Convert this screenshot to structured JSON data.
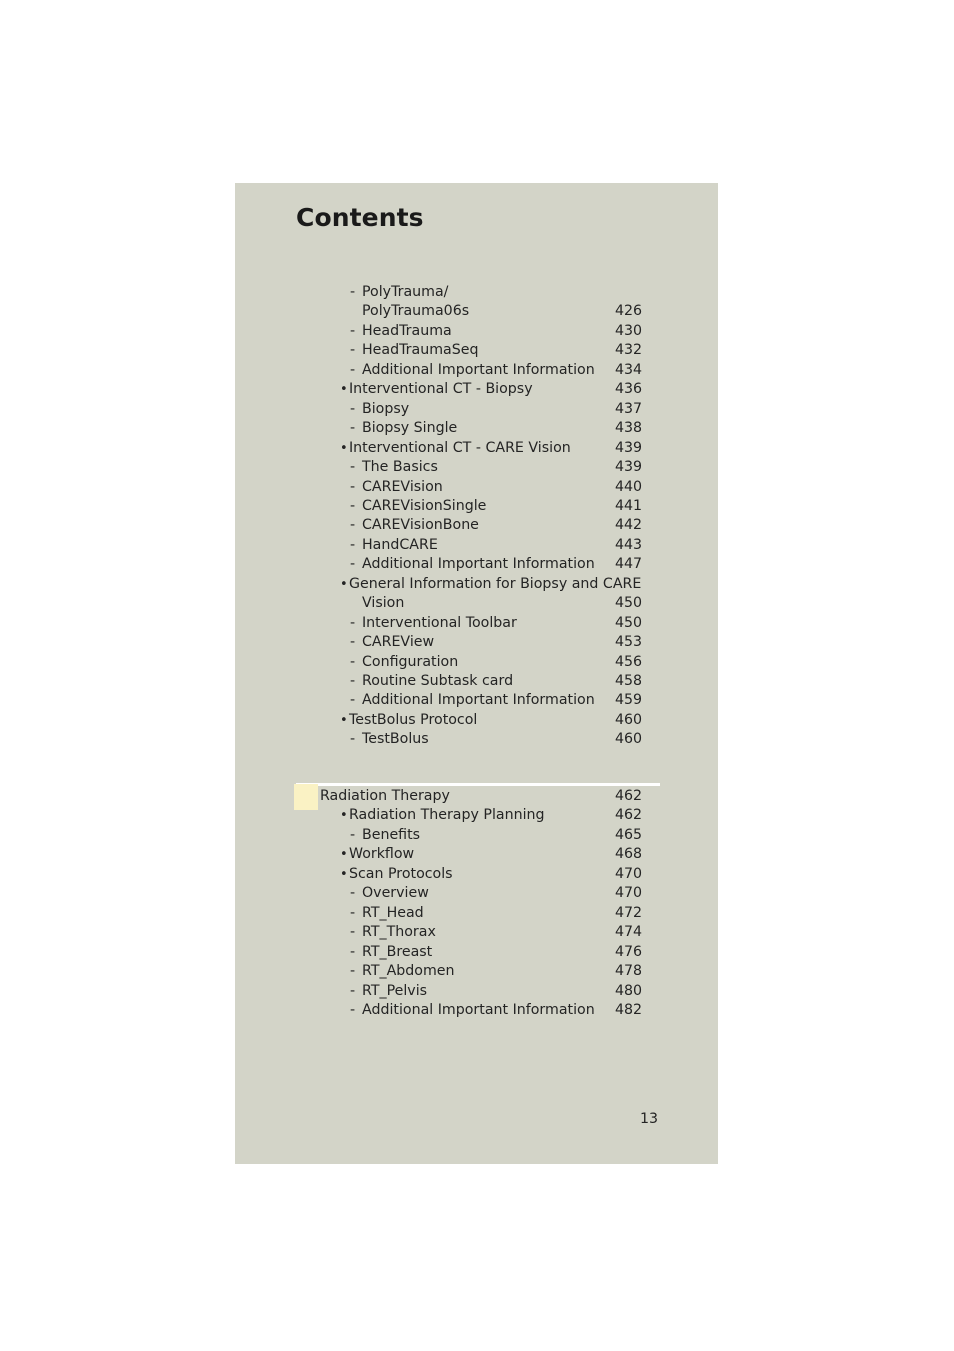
{
  "page": {
    "title": "Contents",
    "folio": "13",
    "background_color": "#d3d4c8",
    "rule_color": "#ffffff",
    "tab_marker_color": "#faf2c4",
    "text_color": "#242424"
  },
  "toc": {
    "group_1": [
      {
        "level": "dash",
        "marker": "-",
        "label": "PolyTrauma/",
        "page": ""
      },
      {
        "level": "cont",
        "marker": "",
        "label": "PolyTrauma06s",
        "page": "426"
      },
      {
        "level": "dash",
        "marker": "-",
        "label": "HeadTrauma",
        "page": "430"
      },
      {
        "level": "dash",
        "marker": "-",
        "label": "HeadTraumaSeq",
        "page": "432"
      },
      {
        "level": "dash",
        "marker": "-",
        "label": "Additional Important Information",
        "page": "434"
      },
      {
        "level": "bullet",
        "marker": "•",
        "label": "Interventional CT - Biopsy",
        "page": "436"
      },
      {
        "level": "dash",
        "marker": "-",
        "label": "Biopsy",
        "page": "437"
      },
      {
        "level": "dash",
        "marker": "-",
        "label": "Biopsy Single",
        "page": "438"
      },
      {
        "level": "bullet",
        "marker": "•",
        "label": "Interventional CT - CARE Vision",
        "page": "439"
      },
      {
        "level": "dash",
        "marker": "-",
        "label": "The Basics",
        "page": "439"
      },
      {
        "level": "dash",
        "marker": "-",
        "label": "CAREVision",
        "page": "440"
      },
      {
        "level": "dash",
        "marker": "-",
        "label": "CAREVisionSingle",
        "page": "441"
      },
      {
        "level": "dash",
        "marker": "-",
        "label": "CAREVisionBone",
        "page": "442"
      },
      {
        "level": "dash",
        "marker": "-",
        "label": "HandCARE",
        "page": "443"
      },
      {
        "level": "dash",
        "marker": "-",
        "label": "Additional Important Information",
        "page": "447"
      },
      {
        "level": "bullet",
        "marker": "•",
        "label": "General Information for Biopsy and CARE",
        "page": ""
      },
      {
        "level": "cont",
        "marker": "",
        "label": "Vision",
        "page": "450"
      },
      {
        "level": "dash",
        "marker": "-",
        "label": "Interventional Toolbar",
        "page": "450"
      },
      {
        "level": "dash",
        "marker": "-",
        "label": "CAREView",
        "page": "453"
      },
      {
        "level": "dash",
        "marker": "-",
        "label": "Configuration",
        "page": "456"
      },
      {
        "level": "dash",
        "marker": "-",
        "label": "Routine Subtask card",
        "page": "458"
      },
      {
        "level": "dash",
        "marker": "-",
        "label": "Additional Important Information",
        "page": "459"
      },
      {
        "level": "bullet",
        "marker": "•",
        "label": "TestBolus Protocol",
        "page": "460"
      },
      {
        "level": "dash",
        "marker": "-",
        "label": "TestBolus",
        "page": "460"
      }
    ],
    "group_2": [
      {
        "level": "section",
        "marker": "",
        "label": "Radiation Therapy",
        "page": "462"
      },
      {
        "level": "bullet",
        "marker": "•",
        "label": "Radiation Therapy Planning",
        "page": "462"
      },
      {
        "level": "dash",
        "marker": "-",
        "label": "Benefits",
        "page": "465"
      },
      {
        "level": "bullet",
        "marker": "•",
        "label": "Workflow",
        "page": "468"
      },
      {
        "level": "bullet",
        "marker": "•",
        "label": "Scan Protocols",
        "page": "470"
      },
      {
        "level": "dash",
        "marker": "-",
        "label": "Overview",
        "page": "470"
      },
      {
        "level": "dash",
        "marker": "-",
        "label": "RT_Head",
        "page": "472"
      },
      {
        "level": "dash",
        "marker": "-",
        "label": "RT_Thorax",
        "page": "474"
      },
      {
        "level": "dash",
        "marker": "-",
        "label": "RT_Breast",
        "page": "476"
      },
      {
        "level": "dash",
        "marker": "-",
        "label": "RT_Abdomen",
        "page": "478"
      },
      {
        "level": "dash",
        "marker": "-",
        "label": "RT_Pelvis",
        "page": "480"
      },
      {
        "level": "dash",
        "marker": "-",
        "label": "Additional Important Information",
        "page": "482"
      }
    ]
  }
}
